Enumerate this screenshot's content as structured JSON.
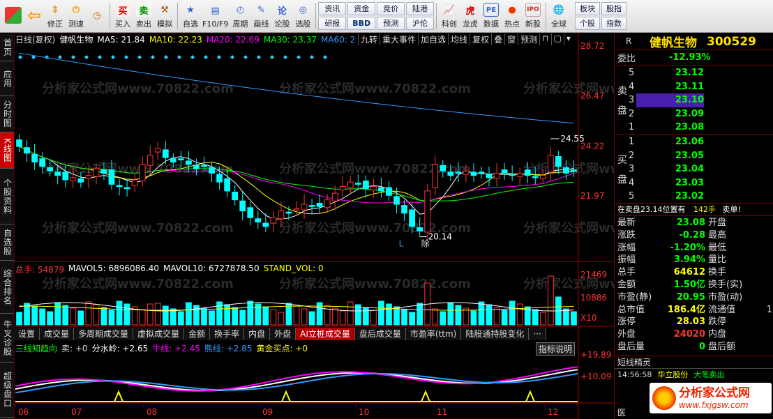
{
  "toolbar": {
    "items": [
      {
        "label": "",
        "icon": "grid-icon"
      },
      {
        "label": "",
        "icon": "back-arrow-icon"
      },
      {
        "label": "修正",
        "icon": "updown-arrows-icon"
      },
      {
        "label": "测速",
        "icon": "power-icon"
      },
      {
        "label": "",
        "icon": "clock-icon"
      },
      {
        "label": "买入",
        "icon": "buy-icon"
      },
      {
        "label": "卖出",
        "icon": "sell-icon"
      },
      {
        "label": "模拟",
        "icon": "hammer-icon"
      },
      {
        "label": "自选",
        "icon": "star-icon"
      },
      {
        "label": "F10/F9",
        "icon": "f10-icon"
      },
      {
        "label": "周期",
        "icon": "cycle-icon"
      },
      {
        "label": "画线",
        "icon": "pencil-icon"
      },
      {
        "label": "论股",
        "icon": "chat-icon"
      },
      {
        "label": "选股",
        "icon": "select-icon"
      }
    ],
    "grid": [
      "资讯",
      "资金",
      "竞价",
      "陆港",
      "研报",
      "BBD",
      "预测",
      "沪伦"
    ],
    "right_items": [
      {
        "label": "科创",
        "icon": "chart-icon"
      },
      {
        "label": "龙虎",
        "icon": "tiger-icon"
      },
      {
        "label": "数据",
        "icon": "pe-icon"
      },
      {
        "label": "热点",
        "icon": "hot-icon"
      },
      {
        "label": "新股",
        "icon": "ipo-icon"
      },
      {
        "label": "全球",
        "icon": "globe-icon"
      }
    ],
    "grid2": [
      "板块",
      "股指",
      "个股",
      "指数"
    ]
  },
  "left_tabs": [
    "首页",
    "应用",
    "分时图",
    "K线图",
    "个股资料",
    "自选股",
    "综合排名",
    "牛叉诊股",
    "超级盘口"
  ],
  "chart_header": {
    "period": "日线(复权)",
    "stock": "健帆生物",
    "ma5": "MA5: 21.84",
    "ma10": "MA10: 22.23",
    "ma20": "MA20: 22.69",
    "ma30": "MA30: 23.37",
    "ma60": "MA60: 2",
    "buttons": [
      "九转",
      "重大事件",
      "加自选",
      "均线",
      "复权",
      "叠",
      "窗",
      "预测"
    ]
  },
  "price_axis": [
    "28.72",
    "26.47",
    "24.22",
    "21.97"
  ],
  "annotations": {
    "high": "24.55",
    "low": "20.14",
    "l_mark": "L",
    "ex_mark": "除"
  },
  "volume_header": {
    "total": "总手: 54879",
    "mavol5": "MAVOL5: 6896086.40",
    "mavol10": "MAVOL10: 6727878.50",
    "std": "STAND_VOL: 0"
  },
  "volume_axis": [
    "21469",
    "10886",
    "X10"
  ],
  "sub_tabs": [
    "设置",
    "成交量",
    "多周期成交量",
    "虚拟成交量",
    "金额",
    "换手率",
    "内盘",
    "外盘",
    "AI立桩成交量",
    "盘后成交量",
    "市盈率(ttm)",
    "陆股通持股变化",
    "···"
  ],
  "indicator_header": {
    "name": "三线知趋向",
    "sell": "卖: +0",
    "water": "分水岭: +2.65",
    "bull": "牛线: +2.45",
    "bear": "熊线: +2.85",
    "gold": "黄金买点: +0",
    "help": "指标说明"
  },
  "indicator_axis": [
    "+19.89",
    "+10.09"
  ],
  "x_axis": [
    "06",
    "07",
    "08",
    "09",
    "10",
    "11",
    "12"
  ],
  "watermark": "分析家公式网www.70822.com",
  "right": {
    "title": "健帆生物",
    "code": "300529",
    "r": "R",
    "weibi_label": "委比",
    "weibi_value": "-12.93%",
    "sell_label": [
      "卖",
      "盘"
    ],
    "buy_label": [
      "买",
      "盘"
    ],
    "asks": [
      {
        "n": "5",
        "p": "23.12"
      },
      {
        "n": "4",
        "p": "23.11"
      },
      {
        "n": "3",
        "p": "23.10"
      },
      {
        "n": "2",
        "p": "23.09"
      },
      {
        "n": "1",
        "p": "23.08"
      }
    ],
    "bids": [
      {
        "n": "1",
        "p": "23.06"
      },
      {
        "n": "2",
        "p": "23.05"
      },
      {
        "n": "3",
        "p": "23.04"
      },
      {
        "n": "4",
        "p": "23.03"
      },
      {
        "n": "5",
        "p": "23.02"
      }
    ],
    "status_line": "在卖盘23.14位置有",
    "status_qty": "142手",
    "status_tail": "卖单!",
    "stats": [
      {
        "k": "最新",
        "v": "23.08",
        "k2": "开盘"
      },
      {
        "k": "涨跌",
        "v": "-0.28",
        "k2": "最高"
      },
      {
        "k": "涨幅",
        "v": "-1.20%",
        "k2": "最低"
      },
      {
        "k": "振幅",
        "v": "3.94%",
        "k2": "量比"
      },
      {
        "k": "总手",
        "v": "64612",
        "k2": "换手"
      },
      {
        "k": "金额",
        "v": "1.50亿",
        "k2": "换手(实)"
      },
      {
        "k": "市盈(静)",
        "v": "20.95",
        "k2": "市盈(动)"
      },
      {
        "k": "总市值",
        "v": "186.4亿",
        "k2": "流通值"
      },
      {
        "k": "涨停",
        "v": "28.03",
        "k2": "跌停"
      },
      {
        "k": "外盘",
        "v": "24020",
        "k2": "内盘"
      },
      {
        "k": "盘后量",
        "v": "0",
        "k2": "盘后额"
      }
    ],
    "extra": "1",
    "sprite_title": "短线精灵",
    "sprite_row": {
      "time": "14:56:58",
      "name": "华立股份",
      "event": "大笔卖出"
    },
    "logo_text": "分析家公式网",
    "logo_url": "www.fxjgsw.com",
    "bottom_label": "医"
  },
  "chart_data": {
    "type": "candlestick",
    "ylim": [
      19.5,
      28.72
    ],
    "closes": [
      24.2,
      23.9,
      23.5,
      23.3,
      23.1,
      22.9,
      22.7,
      22.8,
      22.6,
      22.9,
      23.2,
      23.0,
      22.5,
      22.4,
      22.3,
      22.7,
      23.4,
      23.8,
      24.1,
      23.7,
      23.5,
      23.6,
      23.4,
      23.2,
      23.3,
      23.0,
      22.6,
      22.2,
      21.8,
      21.3,
      21.0,
      20.8,
      20.6,
      21.0,
      21.3,
      21.2,
      21.4,
      21.6,
      21.5,
      21.5,
      21.8,
      22.1,
      22.4,
      22.6,
      22.5,
      22.3,
      22.4,
      22.2,
      22.0,
      21.6,
      21.2,
      20.6,
      20.4,
      22.2,
      23.4,
      23.1,
      22.9,
      23.0,
      23.1,
      22.9,
      23.0,
      22.8,
      23.0,
      23.0,
      22.9,
      23.0,
      22.9,
      22.8,
      22.9,
      23.8,
      23.3,
      23.0,
      23.08
    ]
  }
}
